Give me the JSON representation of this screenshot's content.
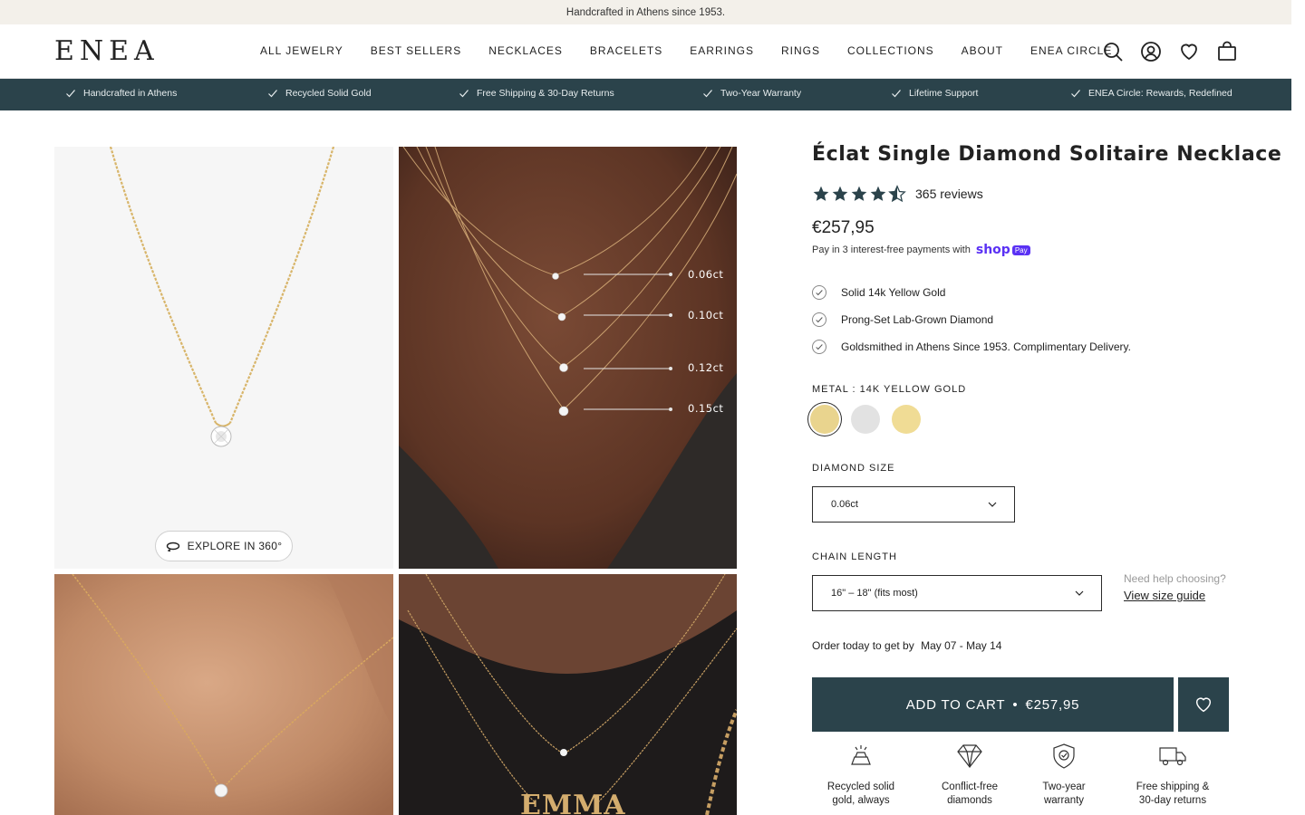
{
  "announcement": "Handcrafted in Athens since 1953.",
  "brand": "ENEA",
  "nav": [
    "ALL JEWELRY",
    "BEST SELLERS",
    "NECKLACES",
    "BRACELETS",
    "EARRINGS",
    "RINGS",
    "COLLECTIONS",
    "ABOUT",
    "ENEA CIRCLE"
  ],
  "header_icons": [
    "search-icon",
    "account-icon",
    "heart-icon",
    "bag-icon"
  ],
  "usp": [
    "Handcrafted in Athens",
    "Recycled Solid Gold",
    "Free Shipping & 30-Day Returns",
    "Two-Year Warranty",
    "Lifetime Support",
    "ENEA Circle: Rewards, Redefined"
  ],
  "gallery": {
    "explore_label": "EXPLORE IN 360°",
    "size_labels": [
      "0.06ct",
      "0.10ct",
      "0.12ct",
      "0.15ct"
    ],
    "name_pendant": "EMMA"
  },
  "product": {
    "title": "Éclat Single Diamond Solitaire Necklace",
    "rating": 4.5,
    "reviews": "365 reviews",
    "price": "€257,95",
    "pay_text": "Pay in 3 interest-free payments with",
    "pay_brand": "shop",
    "pay_badge": "Pay",
    "features": [
      "Solid 14k Yellow Gold",
      "Prong-Set Lab-Grown Diamond",
      "Goldsmithed in Athens Since 1953. Complimentary Delivery."
    ],
    "metal_label": "METAL :",
    "metal_value": "14K YELLOW GOLD",
    "metal_swatches": [
      "#e9d48e",
      "#e2e2e2",
      "#f0dc95"
    ],
    "diamond_label": "DIAMOND SIZE",
    "diamond_value": "0.06ct",
    "chain_label": "CHAIN LENGTH",
    "chain_value": "16\" – 18\" (fits most)",
    "help_question": "Need help choosing?",
    "help_link": "View size guide",
    "order_text": "Order today to get by",
    "order_dates": "May 07 - May 14",
    "cart_label": "ADD TO CART",
    "cart_price": "€257,95"
  },
  "trust": [
    {
      "icon": "gold-bar-icon",
      "line1": "Recycled solid",
      "line2": "gold, always"
    },
    {
      "icon": "diamond-icon",
      "line1": "Conflict-free",
      "line2": "diamonds"
    },
    {
      "icon": "shield-icon",
      "line1": "Two-year",
      "line2": "warranty"
    },
    {
      "icon": "truck-icon",
      "line1": "Free shipping &",
      "line2": "30-day returns"
    }
  ],
  "colors": {
    "accent": "#2b434b",
    "announce_bg": "#f3f0ea",
    "gold": "#d8b56a"
  }
}
